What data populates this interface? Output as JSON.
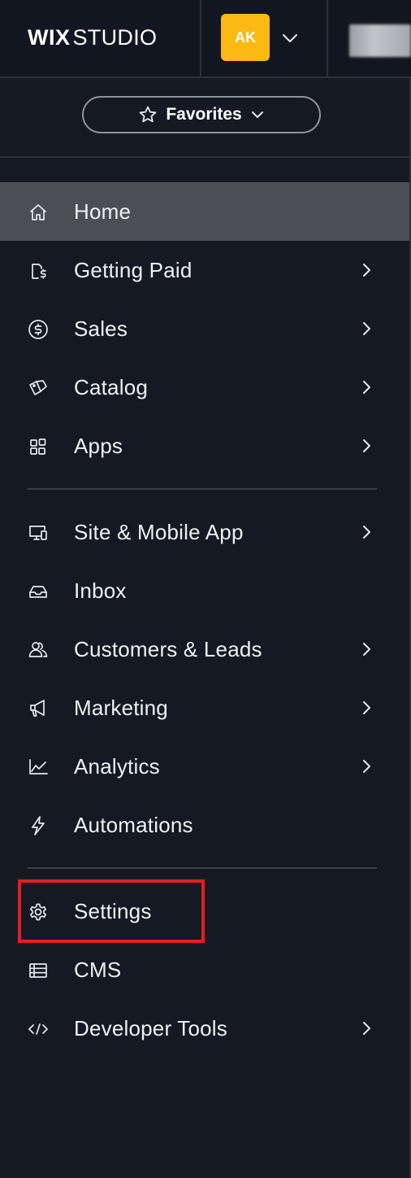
{
  "header": {
    "logo_bold": "WIX",
    "logo_light": "STUDIO",
    "avatar_initials": "AK",
    "avatar_color": "#fcb813"
  },
  "favorites": {
    "label": "Favorites"
  },
  "nav": {
    "home": "Home",
    "getting_paid": "Getting Paid",
    "sales": "Sales",
    "catalog": "Catalog",
    "apps": "Apps",
    "site_mobile_app": "Site & Mobile App",
    "inbox": "Inbox",
    "customers_leads": "Customers & Leads",
    "marketing": "Marketing",
    "analytics": "Analytics",
    "automations": "Automations",
    "settings": "Settings",
    "cms": "CMS",
    "developer_tools": "Developer Tools"
  },
  "colors": {
    "sidebar_bg": "#151924",
    "active_bg": "#4b4e55",
    "highlight_border": "#e02020"
  }
}
